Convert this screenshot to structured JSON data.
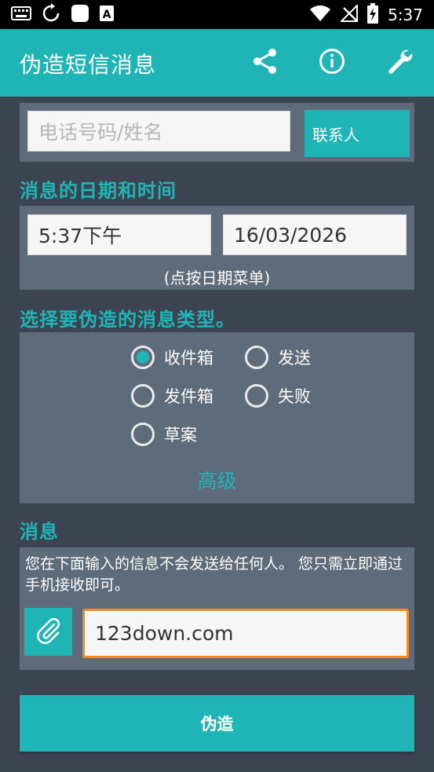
{
  "status_bar": {
    "time": "5:37",
    "icons": [
      "keyboard-icon",
      "sync-icon",
      "square-app-icon",
      "a-notification-icon",
      "wifi-icon",
      "no-signal-icon",
      "battery-charging-icon"
    ]
  },
  "app_bar": {
    "title": "伪造短信消息",
    "actions": [
      "share-icon",
      "info-icon",
      "wrench-icon"
    ]
  },
  "recipient": {
    "placeholder": "电话号码/姓名",
    "value": "",
    "contacts_button": "联系人"
  },
  "datetime": {
    "section_title": "消息的日期和时间",
    "time_value": "5:37下午",
    "date_value": "16/03/2026",
    "hint": "(点按日期菜单)"
  },
  "message_type": {
    "section_title": "选择要伪造的消息类型。",
    "options": [
      {
        "label": "收件箱",
        "checked": true
      },
      {
        "label": "发送",
        "checked": false
      },
      {
        "label": "发件箱",
        "checked": false
      },
      {
        "label": "失败",
        "checked": false
      },
      {
        "label": "草案",
        "checked": false
      }
    ],
    "advanced_label": "高级"
  },
  "message": {
    "section_title": "消息",
    "notice": "您在下面输入的信息不会发送给任何人。 您只需立即通过手机接收即可。",
    "value": "123down.com"
  },
  "submit_label": "伪造",
  "colors": {
    "accent": "#1fb5b7",
    "background": "#3d4451",
    "panel": "#5e6b7b",
    "focus_border": "#f28c1e"
  }
}
